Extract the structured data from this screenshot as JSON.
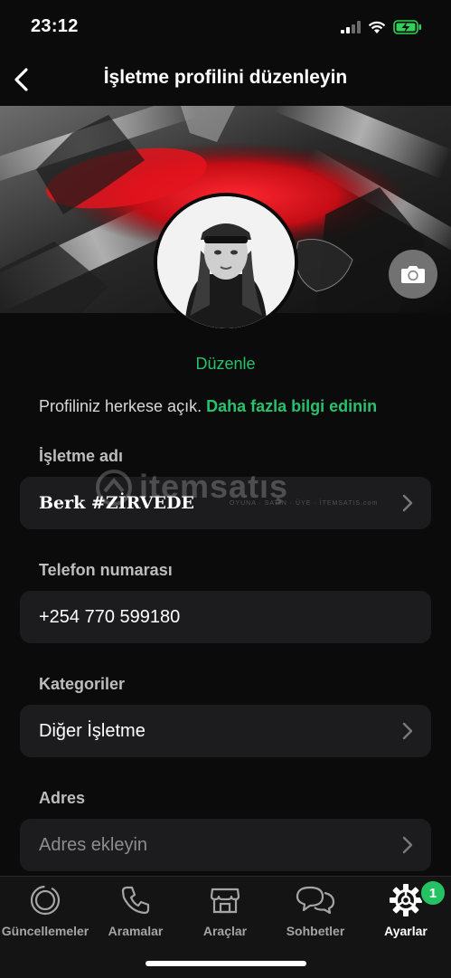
{
  "status": {
    "time": "23:12"
  },
  "nav": {
    "title": "İşletme profilini düzenleyin"
  },
  "profile": {
    "edit_label": "Düzenle",
    "public_note": "Profiliniz herkese açık.",
    "public_link": "Daha fazla bilgi edinin"
  },
  "fields": {
    "business_name": {
      "label": "İşletme adı",
      "value": "Berk #ZİRVEDE"
    },
    "phone": {
      "label": "Telefon numarası",
      "value": "+254 770 599180"
    },
    "categories": {
      "label": "Kategoriler",
      "value": "Diğer İşletme"
    },
    "address": {
      "label": "Adres",
      "placeholder": "Adres ekleyin"
    }
  },
  "watermark": {
    "text": "itemsatış",
    "sub": "OYUNA · SATIN · ÜYE · İTEMSATIS.com"
  },
  "tabs": [
    {
      "label": "Güncellemeler",
      "icon": "updates-icon"
    },
    {
      "label": "Aramalar",
      "icon": "phone-icon"
    },
    {
      "label": "Araçlar",
      "icon": "store-icon"
    },
    {
      "label": "Sohbetler",
      "icon": "chats-icon"
    },
    {
      "label": "Ayarlar",
      "icon": "settings-icon",
      "badge": "1",
      "active": true
    }
  ],
  "colors": {
    "accent": "#27c26b",
    "background": "#0b0b0b",
    "field": "#1c1c1e",
    "cover_red": "#d41118"
  }
}
